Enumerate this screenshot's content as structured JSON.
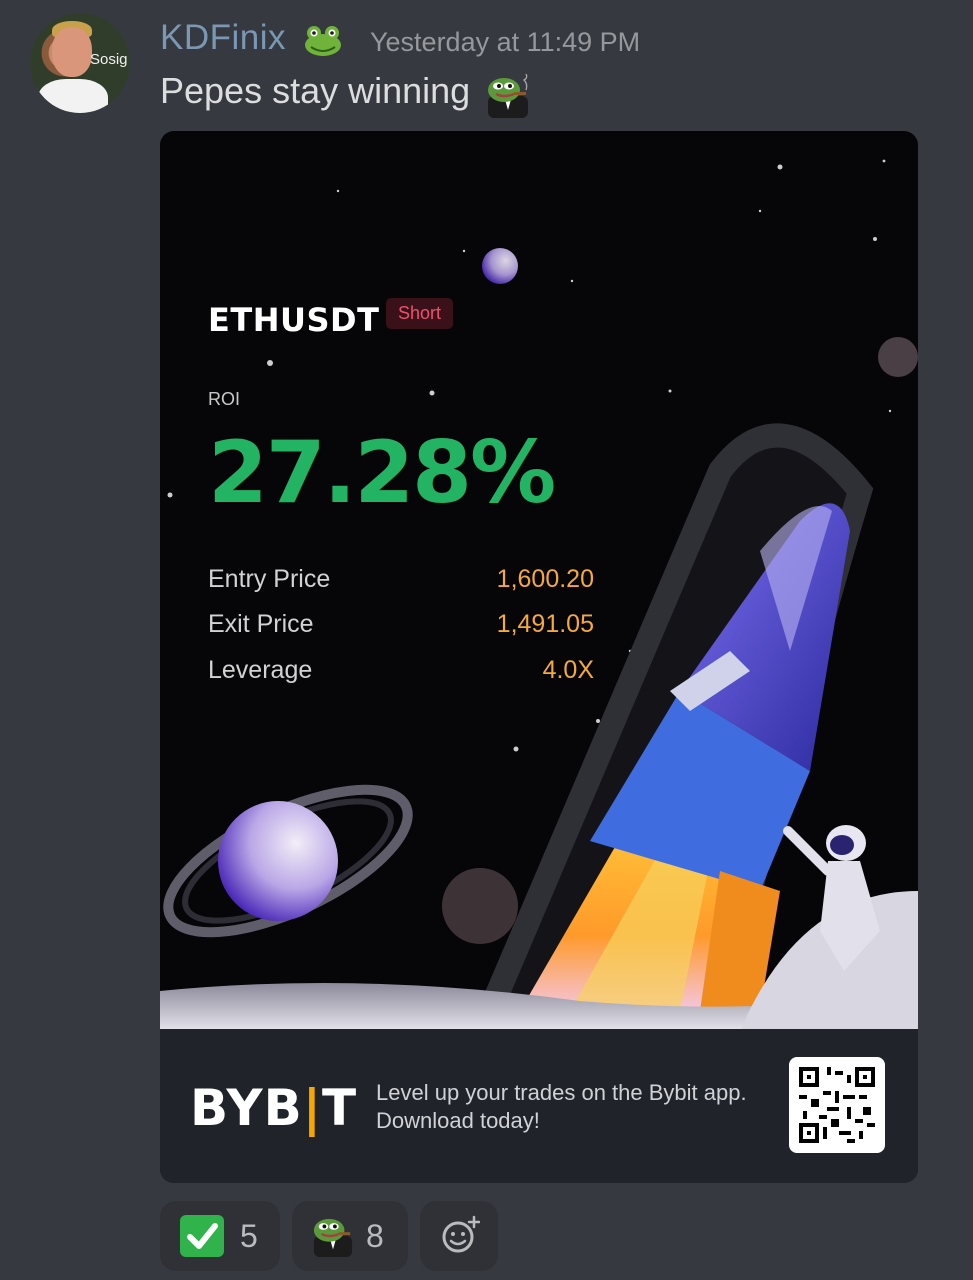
{
  "author": {
    "avatar_text": "Sosig",
    "username": "KDFinix",
    "badge_icon": "frog-icon",
    "timestamp": "Yesterday at 11:49 PM"
  },
  "message": {
    "text": "Pepes stay winning",
    "emoji": "pepe-tuxedo-icon"
  },
  "trade_card": {
    "pair": "ETHUSDT",
    "side": "Short",
    "roi_label": "ROI",
    "roi_value": "27.28%",
    "stats": [
      {
        "label": "Entry Price",
        "value": "1,600.20"
      },
      {
        "label": "Exit Price",
        "value": "1,491.05"
      },
      {
        "label": "Leverage",
        "value": "4.0X"
      }
    ],
    "brand_left": "BYB",
    "brand_right": "T",
    "promo_line1": "Level up your trades on the Bybit app.",
    "promo_line2": "Download today!",
    "colors": {
      "roi": "#22b463",
      "side": "#f0506e",
      "value": "#f4a93b",
      "brand_accent": "#f7a600"
    }
  },
  "reactions": [
    {
      "icon": "check-mark-icon",
      "count": "5"
    },
    {
      "icon": "pepe-tuxedo-icon",
      "count": "8"
    },
    {
      "icon": "add-reaction-icon",
      "count": ""
    }
  ]
}
